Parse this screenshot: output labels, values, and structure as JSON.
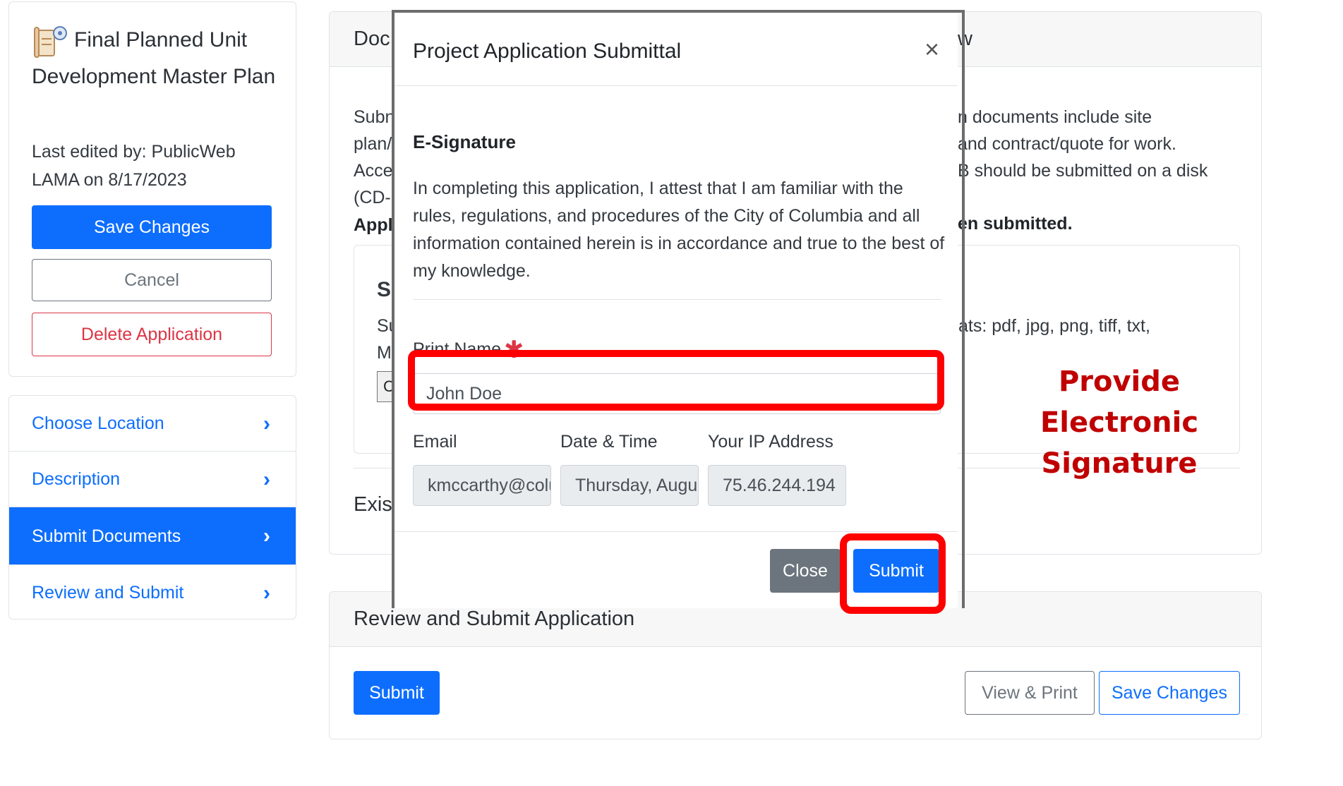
{
  "app": {
    "title": "Final Planned Unit Development Master Plan",
    "last_edited": "Last edited by: PublicWeb LAMA on 8/17/2023",
    "save_label": "Save Changes",
    "cancel_label": "Cancel",
    "delete_label": "Delete Application",
    "icon": "document-gear-icon"
  },
  "nav": {
    "items": [
      {
        "label": "Choose Location"
      },
      {
        "label": "Description"
      },
      {
        "label": "Submit Documents",
        "active": true
      },
      {
        "label": "Review and Submit"
      }
    ],
    "chevron": "›"
  },
  "documents": {
    "title_visible": "Doc",
    "title_tail": "w",
    "desc_left": [
      "Subn",
      "plan/",
      "Acce",
      "(CD-"
    ],
    "desc_right": [
      "n documents include site",
      "and contract/quote for work.",
      "B should be submitted on a disk"
    ],
    "bold_left": "Appl",
    "bold_right": "en submitted.",
    "inner_heading": "S",
    "inner_text1": "Su",
    "inner_text2": "M",
    "inner_formats": "ats: pdf, jpg, png, tiff, txt,",
    "inner_choose": "C",
    "existing": "Exis"
  },
  "review": {
    "title": "Review and Submit Application",
    "submit_label": "Submit",
    "view_print_label": "View & Print",
    "save_label": "Save Changes"
  },
  "modal": {
    "title": "Project Application Submittal",
    "close_glyph": "×",
    "esig_heading": "E-Signature",
    "attest": "In completing this application, I attest that I am familiar with the rules, regulations, and procedures of the City of Columbia and all information contained herein is in accordance and true to the best of my knowledge.",
    "print_name_label": "Print Name",
    "required_glyph": "✱",
    "print_name_value": "John Doe",
    "email_label": "Email",
    "email_value": "kmccarthy@colur",
    "datetime_label": "Date & Time",
    "datetime_value": "Thursday, August",
    "ip_label": "Your IP Address",
    "ip_value": "75.46.244.194",
    "close_label": "Close",
    "submit_label": "Submit"
  },
  "annotation": {
    "lines": [
      "Provide",
      "Electronic",
      "Signature"
    ],
    "color": "#c00000",
    "highlight_color": "#ff0000"
  },
  "colors": {
    "primary": "#0d6efd",
    "danger": "#dc3545",
    "secondary": "#6c757d"
  }
}
